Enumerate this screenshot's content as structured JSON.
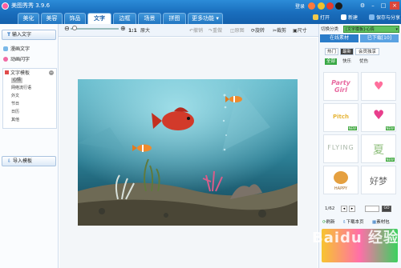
{
  "app": {
    "title": "美图秀秀 3.9.6",
    "login": "登录"
  },
  "tabs": [
    "美化",
    "美容",
    "饰品",
    "文字",
    "边框",
    "场景",
    "拼图",
    "更多功能"
  ],
  "tab_active": "文字",
  "top_actions": {
    "open": "打开",
    "new": "新建",
    "save": "保存与分享"
  },
  "toolbar": {
    "scale_label": "1:1",
    "original": "原大",
    "rotate_left": "撤销",
    "redo": "重做",
    "original_img": "原图",
    "rotate": "旋转",
    "crop": "裁剪",
    "size": "尺寸"
  },
  "left": {
    "input_text": "输入文字",
    "items": [
      "漫画文字",
      "动画闪字"
    ],
    "tree_title": "文字模板",
    "tree_items": [
      "心情",
      "网络流行语",
      "外文",
      "节日",
      "日历",
      "其他"
    ],
    "import_btn": "导入模板"
  },
  "right": {
    "switch_label": "切换分类",
    "switch_value": "[文字模板]-心情",
    "tab_online": "在线素材",
    "tab_downloaded": "已下载[10]",
    "subtabs": [
      "热门",
      "最新",
      "会员独享"
    ],
    "categories": [
      "全部",
      "快乐",
      "忧伤"
    ],
    "thumbs": [
      "Party Girl",
      "heart",
      "Pitch",
      "heart-balloon",
      "FLYING",
      "夏",
      "HAPPY",
      "好梦"
    ],
    "page": "1/62",
    "go_label": "GO",
    "refresh": "刷新",
    "download_page": "下载本页",
    "material_pack": "素材包"
  },
  "watermark": "Baidu 经验"
}
